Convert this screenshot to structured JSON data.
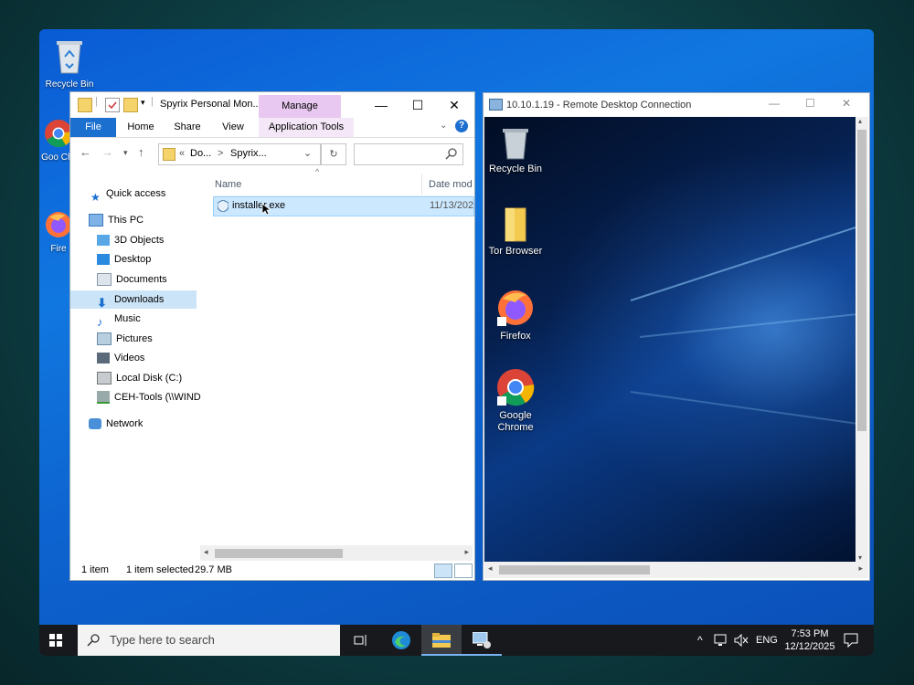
{
  "desktop": {
    "icons": [
      {
        "label": "Recycle Bin",
        "icon": "recycle-bin-icon"
      },
      {
        "label": "Goo Chr",
        "icon": "chrome-icon"
      },
      {
        "label": "Fire",
        "icon": "firefox-icon"
      }
    ]
  },
  "explorer": {
    "title": "Spyrix Personal Mon...",
    "manage_tab": "Manage",
    "ribbon_tabs": [
      "File",
      "Home",
      "Share",
      "View",
      "Application Tools"
    ],
    "address_crumbs": [
      "«",
      "Do...",
      ">",
      "Spyrix..."
    ],
    "nav_items": [
      {
        "label": "Quick access",
        "icon": "star-icon"
      },
      {
        "label": "This PC",
        "icon": "computer-icon"
      },
      {
        "label": "3D Objects",
        "icon": "cube-icon"
      },
      {
        "label": "Desktop",
        "icon": "desktop-folder-icon"
      },
      {
        "label": "Documents",
        "icon": "documents-icon"
      },
      {
        "label": "Downloads",
        "icon": "download-icon"
      },
      {
        "label": "Music",
        "icon": "music-icon"
      },
      {
        "label": "Pictures",
        "icon": "pictures-icon"
      },
      {
        "label": "Videos",
        "icon": "videos-icon"
      },
      {
        "label": "Local Disk (C:)",
        "icon": "disk-icon"
      },
      {
        "label": "CEH-Tools (\\\\WIND",
        "icon": "network-drive-icon"
      },
      {
        "label": "Network",
        "icon": "network-icon"
      }
    ],
    "selected_nav": "Downloads",
    "columns": {
      "name": "Name",
      "date": "Date mod"
    },
    "files": [
      {
        "name": "installer.exe",
        "date": "11/13/202"
      }
    ],
    "status": {
      "count": "1 item",
      "selected": "1 item selected",
      "size": "29.7 MB"
    }
  },
  "rdp": {
    "title": "10.10.1.19 - Remote Desktop Connection",
    "icons": [
      {
        "label": "Recycle Bin",
        "icon": "recycle-bin-icon"
      },
      {
        "label": "Tor Browser",
        "icon": "folder-icon"
      },
      {
        "label": "Firefox",
        "icon": "firefox-icon"
      },
      {
        "label": "Google Chrome",
        "icon": "chrome-icon"
      }
    ]
  },
  "taskbar": {
    "search_placeholder": "Type here to search",
    "lang": "ENG",
    "time": "7:53 PM",
    "date": "12/12/2025"
  },
  "colors": {
    "accent": "#1a6fcf",
    "manage_tab": "#e8c8f0",
    "selection": "#cce8ff",
    "taskbar": "#17191d"
  }
}
